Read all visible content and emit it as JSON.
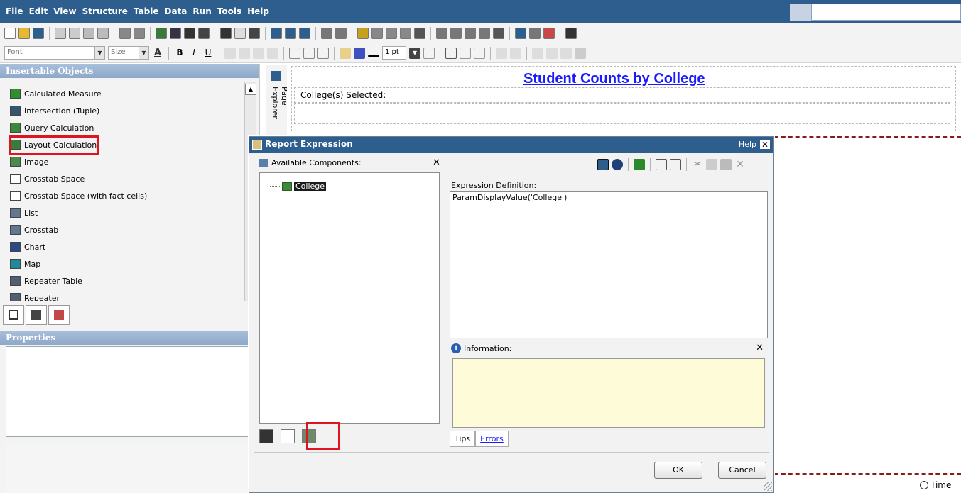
{
  "menu": {
    "items": [
      "File",
      "Edit",
      "View",
      "Structure",
      "Table",
      "Data",
      "Run",
      "Tools",
      "Help"
    ]
  },
  "toolbar2": {
    "font_placeholder": "Font",
    "size_placeholder": "Size",
    "line_width": "1 pt"
  },
  "left_panel": {
    "insertable_header": "Insertable Objects",
    "items": [
      {
        "label": "Calculated Measure",
        "icon": "calculated-measure-icon",
        "color": "#2f8f2f"
      },
      {
        "label": "Intersection (Tuple)",
        "icon": "intersection-icon",
        "color": "#35556e"
      },
      {
        "label": "Query Calculation",
        "icon": "query-calculation-icon",
        "color": "#3a8a3a"
      },
      {
        "label": "Layout Calculation",
        "icon": "layout-calculation-icon",
        "color": "#3a7a3a"
      },
      {
        "label": "Image",
        "icon": "image-icon",
        "color": "#4a8a4a"
      },
      {
        "label": "Crosstab Space",
        "icon": "crosstab-space-icon",
        "color": "#ffffff"
      },
      {
        "label": "Crosstab Space (with fact cells)",
        "icon": "crosstab-space-fact-icon",
        "color": "#ffffff"
      },
      {
        "label": "List",
        "icon": "list-icon",
        "color": "#607890"
      },
      {
        "label": "Crosstab",
        "icon": "crosstab-icon",
        "color": "#607890"
      },
      {
        "label": "Chart",
        "icon": "chart-icon",
        "color": "#2a4a8a"
      },
      {
        "label": "Map",
        "icon": "map-icon",
        "color": "#1f8a9a"
      },
      {
        "label": "Repeater Table",
        "icon": "repeater-table-icon",
        "color": "#506070"
      },
      {
        "label": "Repeater",
        "icon": "repeater-icon",
        "color": "#506070"
      }
    ],
    "properties_header": "Properties"
  },
  "page_explorer": "Page Explorer",
  "report": {
    "title": "Student Counts by College",
    "college_selected": "College(s) Selected:",
    "time_label": "Time"
  },
  "dialog": {
    "title": "Report Expression",
    "help": "Help",
    "available_label": "Available Components:",
    "tree_item": "College",
    "expression_label": "Expression Definition:",
    "expression_value": "ParamDisplayValue('College')",
    "information_label": "Information:",
    "tabs": [
      "Tips",
      "Errors"
    ],
    "ok": "OK",
    "cancel": "Cancel"
  }
}
